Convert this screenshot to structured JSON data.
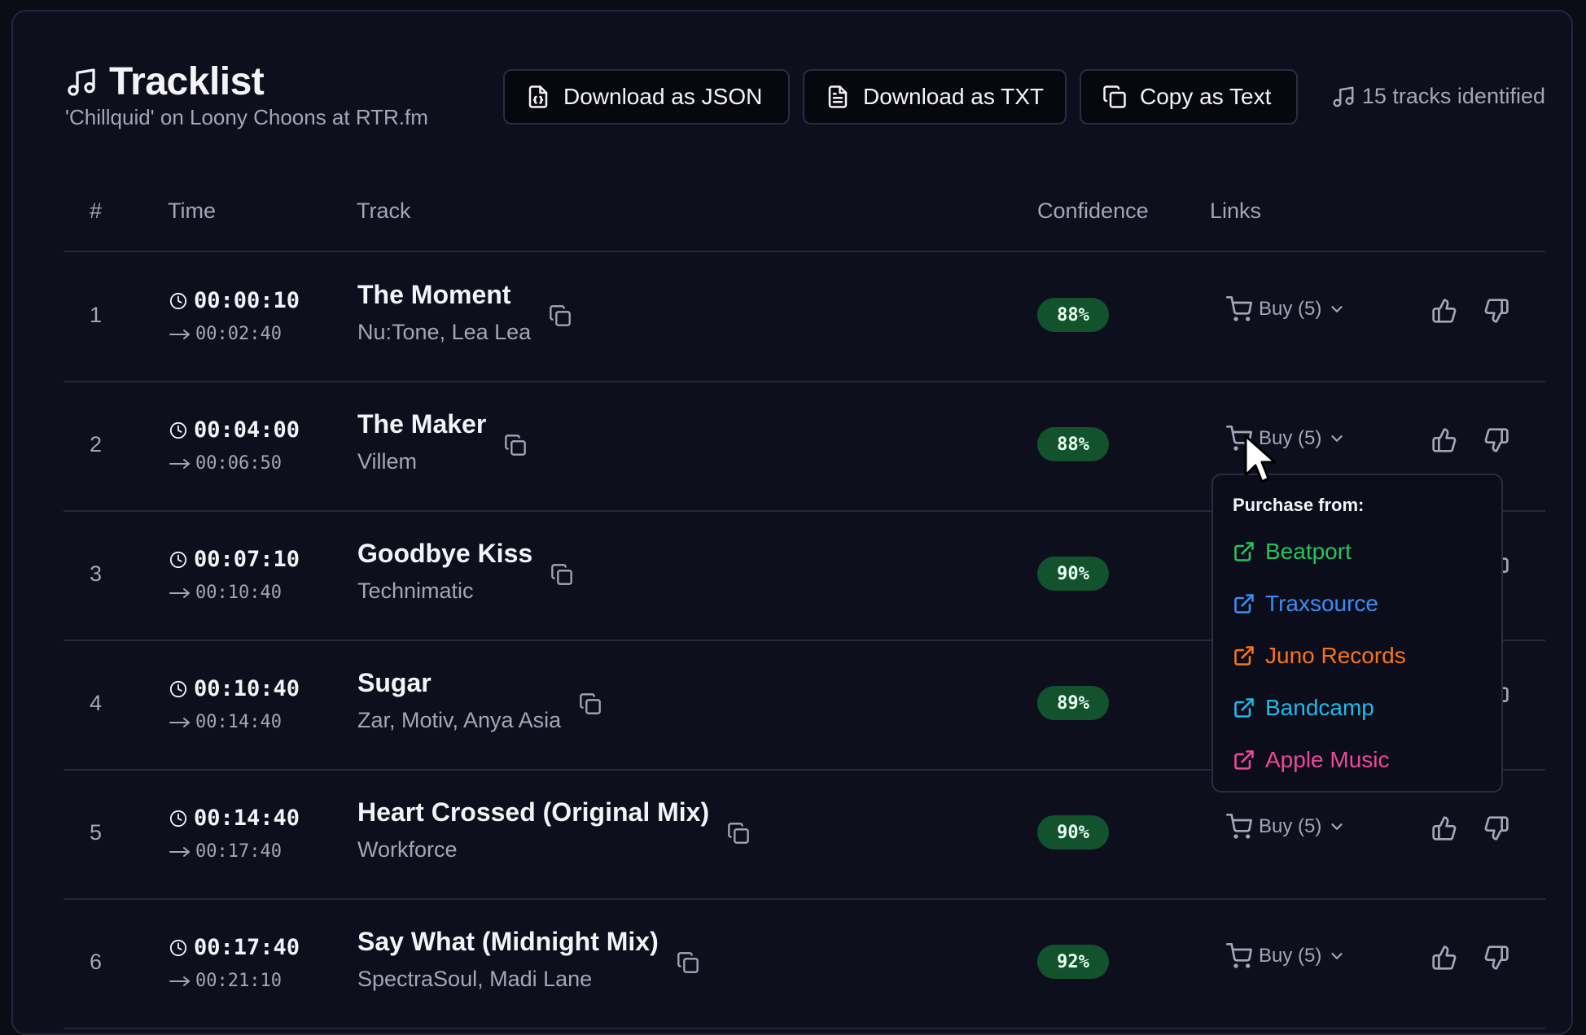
{
  "header": {
    "title": "Tracklist",
    "subtitle": "'Chillquid' on Loony Choons at RTR.fm",
    "title_icon": "music-note-icon",
    "buttons": {
      "json": "Download as JSON",
      "txt": "Download as TXT",
      "copy": "Copy as Text"
    },
    "track_count": "15 tracks identified"
  },
  "columns": {
    "num": "#",
    "time": "Time",
    "track": "Track",
    "confidence": "Confidence",
    "links": "Links"
  },
  "rows": [
    {
      "num": "1",
      "start": "00:00:10",
      "end": "00:02:40",
      "title": "The Moment",
      "artist": "Nu:Tone, Lea Lea",
      "confidence": "88%",
      "buy": "Buy (5)"
    },
    {
      "num": "2",
      "start": "00:04:00",
      "end": "00:06:50",
      "title": "The Maker",
      "artist": "Villem",
      "confidence": "88%",
      "buy": "Buy (5)"
    },
    {
      "num": "3",
      "start": "00:07:10",
      "end": "00:10:40",
      "title": "Goodbye Kiss",
      "artist": "Technimatic",
      "confidence": "90%",
      "buy": "Buy (5)"
    },
    {
      "num": "4",
      "start": "00:10:40",
      "end": "00:14:40",
      "title": "Sugar",
      "artist": "Zar, Motiv, Anya Asia",
      "confidence": "89%",
      "buy": "Buy (5)"
    },
    {
      "num": "5",
      "start": "00:14:40",
      "end": "00:17:40",
      "title": "Heart Crossed (Original Mix)",
      "artist": "Workforce",
      "confidence": "90%",
      "buy": "Buy (5)"
    },
    {
      "num": "6",
      "start": "00:17:40",
      "end": "00:21:10",
      "title": "Say What (Midnight Mix)",
      "artist": "SpectraSoul, Madi Lane",
      "confidence": "92%",
      "buy": "Buy (5)"
    }
  ],
  "dropdown": {
    "title": "Purchase from:",
    "items": [
      {
        "label": "Beatport",
        "color": "#22c55e"
      },
      {
        "label": "Traxsource",
        "color": "#3b8df6"
      },
      {
        "label": "Juno Records",
        "color": "#f97316"
      },
      {
        "label": "Bandcamp",
        "color": "#22b8e8"
      },
      {
        "label": "Apple Music",
        "color": "#ec4899"
      }
    ]
  },
  "colors": {
    "background": "#0c0c17",
    "card": "#0e0f1d",
    "confidence_badge": "#12532e",
    "muted_text": "#a4a6b6"
  }
}
